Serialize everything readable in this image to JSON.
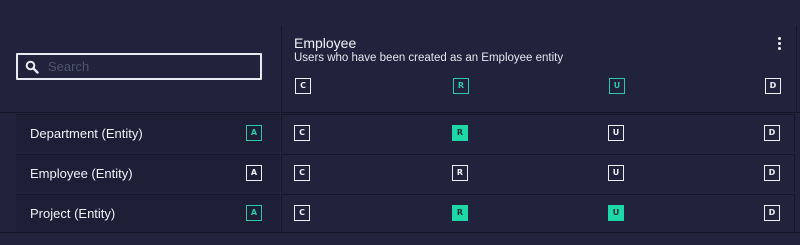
{
  "search": {
    "placeholder": "Search",
    "value": ""
  },
  "column": {
    "title": "Employee",
    "subtitle": "Users who have been created as an Employee entity",
    "header_perms": [
      "C",
      "R",
      "U",
      "D"
    ]
  },
  "rows": [
    {
      "label": "Department (Entity)",
      "admin": "A",
      "perms": [
        "C",
        "R",
        "U",
        "D"
      ]
    },
    {
      "label": "Employee (Entity)",
      "admin": "A",
      "perms": [
        "C",
        "R",
        "U",
        "D"
      ]
    },
    {
      "label": "Project (Entity)",
      "admin": "A",
      "perms": [
        "C",
        "R",
        "U",
        "D"
      ]
    }
  ],
  "colors": {
    "background": "#20233b",
    "accent": "#1fd6a9",
    "accent_outline": "#2ec7a8"
  }
}
